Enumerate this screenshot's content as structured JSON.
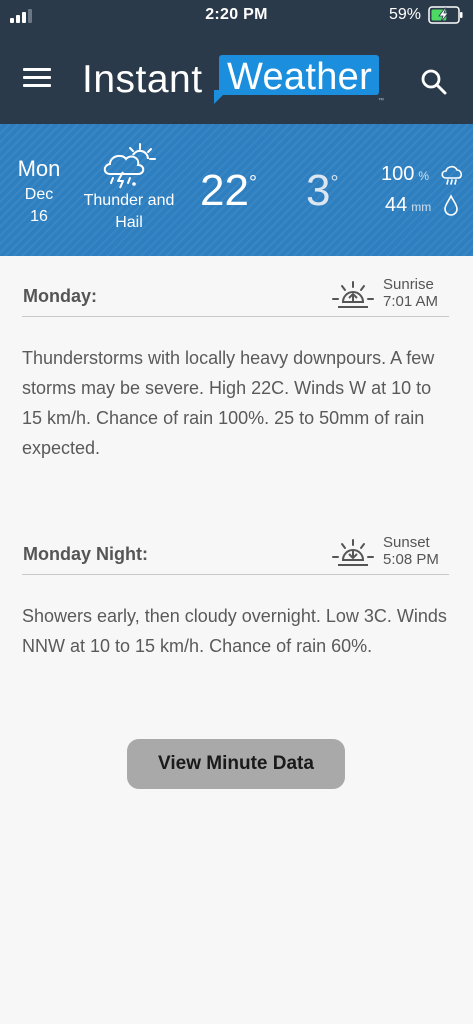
{
  "status_bar": {
    "time": "2:20 PM",
    "battery_percent": "59%",
    "battery_level": 0.59,
    "signal_icon": "cellular-signal-icon",
    "battery_icon": "battery-charging-icon"
  },
  "header": {
    "menu_icon": "hamburger-menu-icon",
    "logo_word_1": "Instant",
    "logo_word_2": "Weather",
    "logo_tm": "™",
    "search_icon": "search-icon",
    "background_color": "#2b3a4a",
    "logo_accent_color": "#1b8fde"
  },
  "today": {
    "day": "Mon",
    "month": "Dec",
    "date": "16",
    "condition": "Thunder and Hail",
    "condition_icon": "thunder-hail-icon",
    "high_temp": "22",
    "low_temp": "3",
    "degree_symbol": "°",
    "rain_chance": "100",
    "rain_chance_unit": "%",
    "rain_amount": "44",
    "rain_amount_unit": "mm",
    "background_color": "#2e7fc0"
  },
  "forecast": [
    {
      "title": "Monday:",
      "sun_label": "Sunrise",
      "sun_time": "7:01 AM",
      "sun_icon": "sunrise-icon",
      "text": "Thunderstorms with locally heavy downpours. A few storms may be severe. High 22C. Winds W at 10 to 15 km/h. Chance of rain 100%. 25 to 50mm of rain expected."
    },
    {
      "title": "Monday Night:",
      "sun_label": "Sunset",
      "sun_time": "5:08 PM",
      "sun_icon": "sunset-icon",
      "text": "Showers early, then cloudy overnight. Low 3C. Winds NNW at 10 to 15 km/h. Chance of rain 60%."
    }
  ],
  "button": {
    "label": "View Minute Data"
  }
}
